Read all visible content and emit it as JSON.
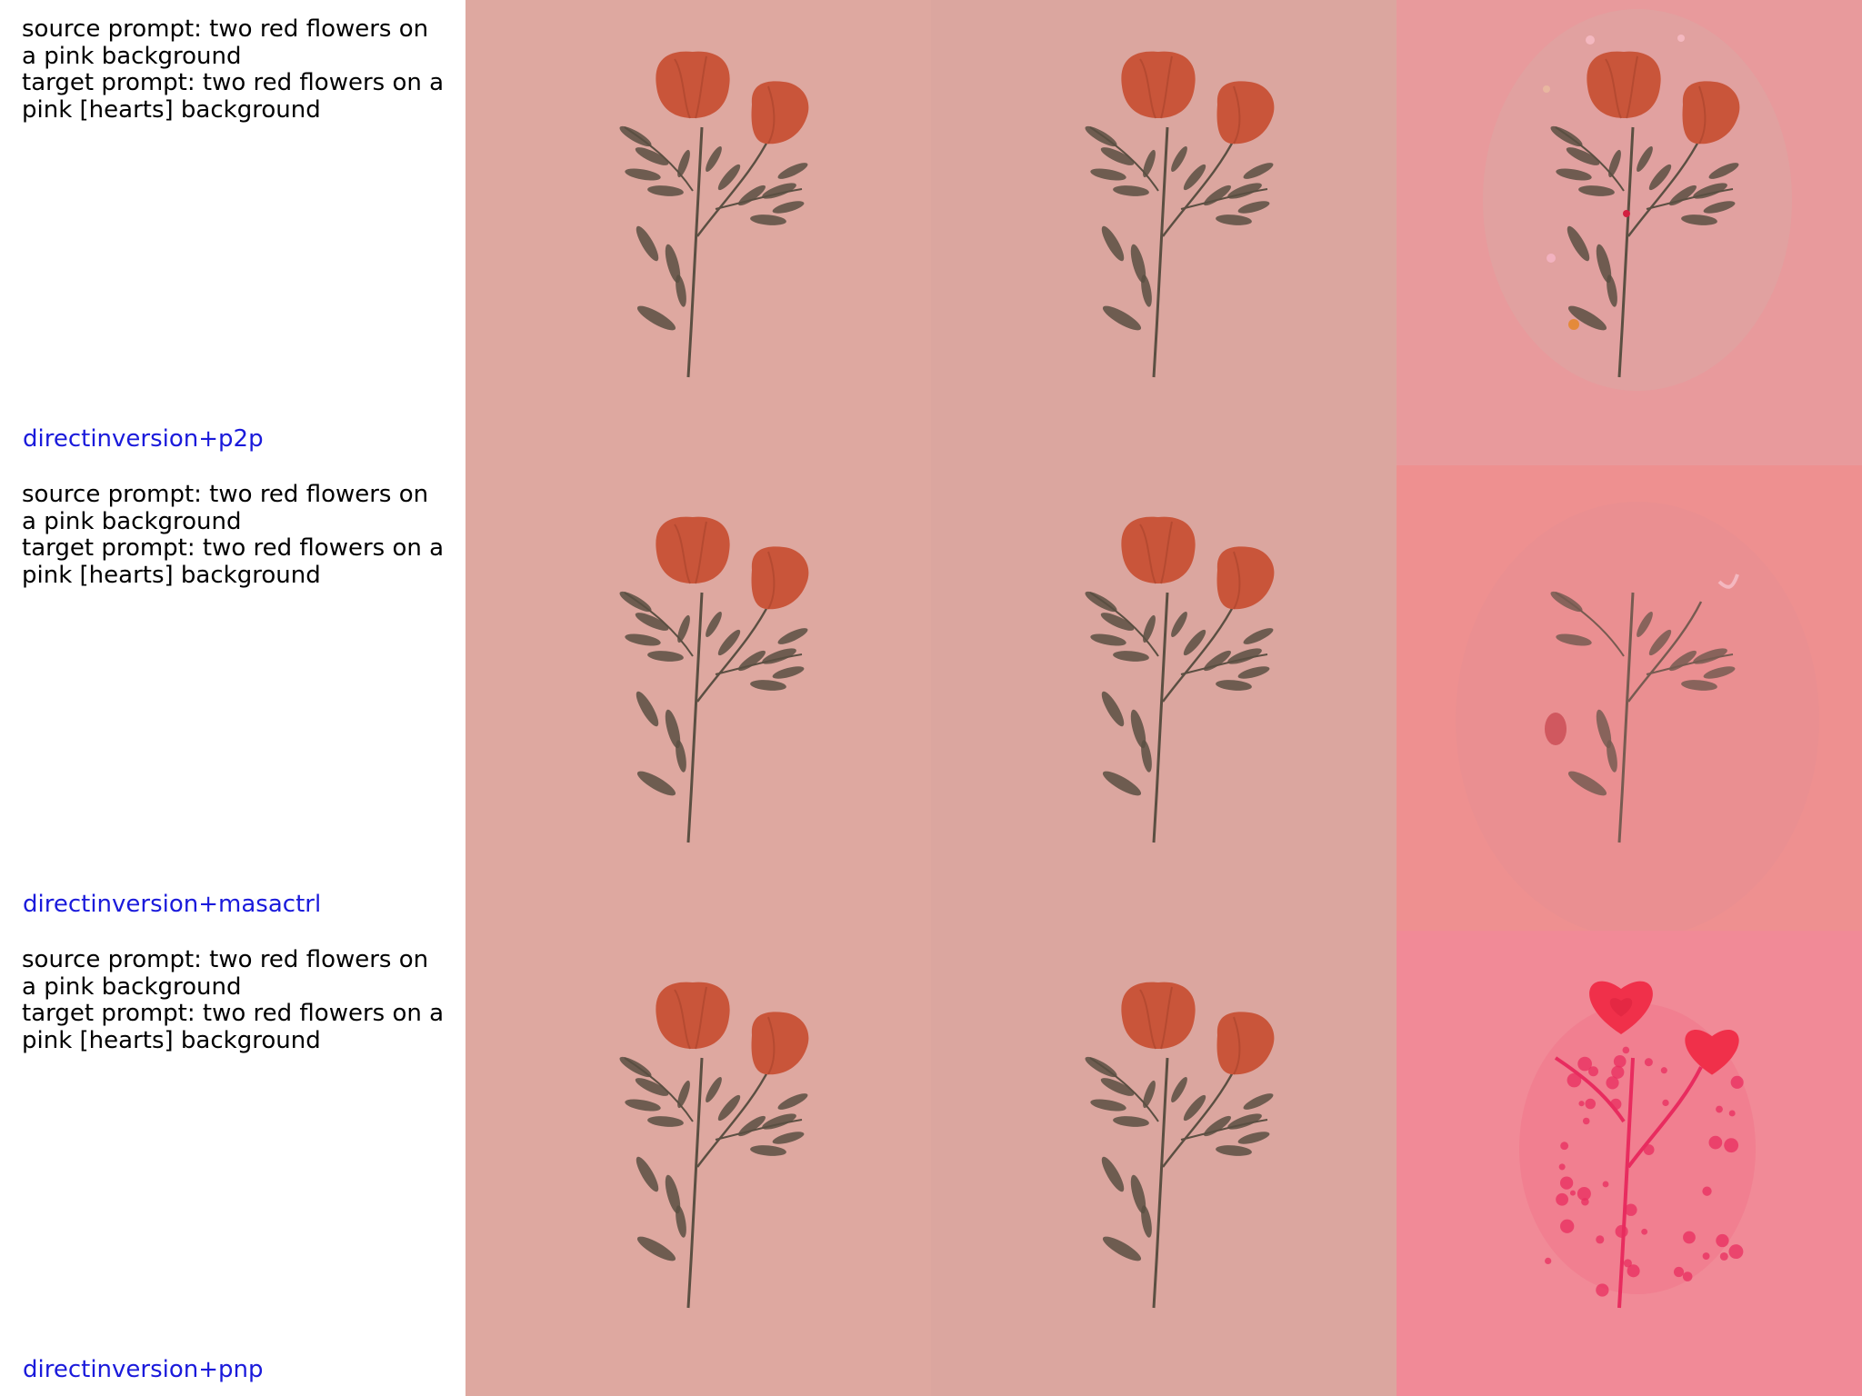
{
  "colors": {
    "method_label": "#1a1adb",
    "bg_source": "#dea8a0",
    "bg_recon": "#dba69f",
    "bg_edit_p2p": "#e89a9c",
    "bg_edit_masactrl": "#ee9090",
    "bg_edit_pnp": "#f18a97",
    "petal": "#c9553a",
    "petal_dark": "#a8432c",
    "leaf": "#5b4f42",
    "heart": "#f0304a"
  },
  "rows": [
    {
      "source_prompt": "source prompt: two red flowers on a pink background",
      "target_prompt": "target prompt: two red flowers on a pink [hearts] background",
      "method": "directinversion+p2p",
      "edit_variant": "p2p"
    },
    {
      "source_prompt": "source prompt: two red flowers on a pink background",
      "target_prompt": "target prompt: two red flowers on a pink [hearts] background",
      "method": "directinversion+masactrl",
      "edit_variant": "masactrl"
    },
    {
      "source_prompt": "source prompt: two red flowers on a pink background",
      "target_prompt": "target prompt: two red flowers on a pink [hearts] background",
      "method": "directinversion+pnp",
      "edit_variant": "pnp"
    }
  ]
}
